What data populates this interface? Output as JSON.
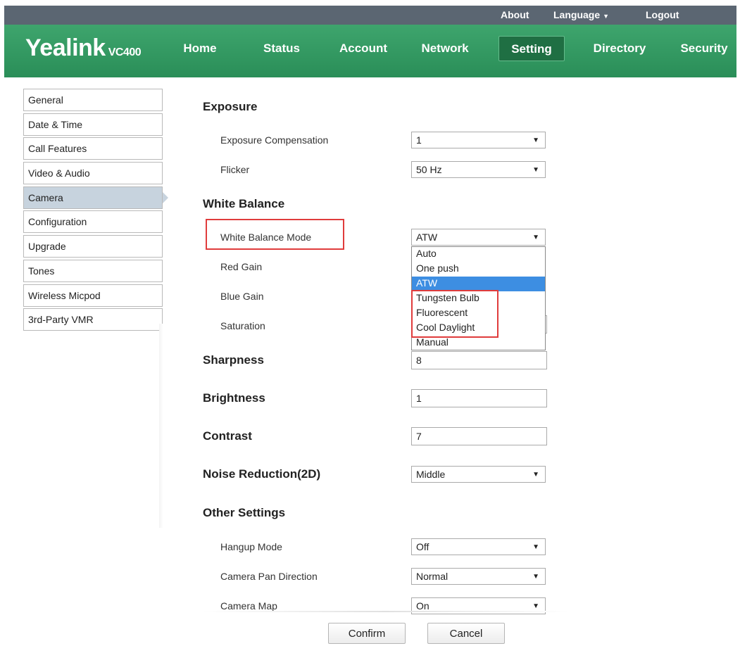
{
  "topbar": {
    "about": "About",
    "language": "Language",
    "logout": "Logout"
  },
  "logo": {
    "brand": "Yealink",
    "model": "VC400"
  },
  "nav": [
    "Home",
    "Status",
    "Account",
    "Network",
    "Setting",
    "Directory",
    "Security"
  ],
  "sidebar": [
    "General",
    "Date & Time",
    "Call Features",
    "Video & Audio",
    "Camera",
    "Configuration",
    "Upgrade",
    "Tones",
    "Wireless Micpod",
    "3rd-Party VMR"
  ],
  "exposure": {
    "title": "Exposure",
    "compensation_label": "Exposure Compensation",
    "compensation_value": "1",
    "flicker_label": "Flicker",
    "flicker_value": "50 Hz"
  },
  "white_balance": {
    "title": "White Balance",
    "mode_label": "White Balance Mode",
    "mode_value": "ATW",
    "options": [
      "Auto",
      "One push",
      "ATW",
      "Tungsten Bulb",
      "Fluorescent",
      "Cool Daylight",
      "Manual"
    ],
    "red_gain_label": "Red Gain",
    "blue_gain_label": "Blue Gain",
    "saturation_label": "Saturation"
  },
  "sharpness": {
    "title": "Sharpness",
    "value": "8"
  },
  "brightness": {
    "title": "Brightness",
    "value": "1"
  },
  "contrast": {
    "title": "Contrast",
    "value": "7"
  },
  "noise_reduction": {
    "title": "Noise Reduction(2D)",
    "value": "Middle"
  },
  "other": {
    "title": "Other Settings",
    "hangup_label": "Hangup Mode",
    "hangup_value": "Off",
    "pan_label": "Camera Pan Direction",
    "pan_value": "Normal",
    "map_label": "Camera Map",
    "map_value": "On"
  },
  "buttons": {
    "confirm": "Confirm",
    "cancel": "Cancel"
  },
  "colors": {
    "header_green": "#2e9660",
    "active_tab": "#1f6f43",
    "topbar": "#5b6672",
    "highlight": "#3d8ee2",
    "annotation_red": "#e03c3c"
  }
}
